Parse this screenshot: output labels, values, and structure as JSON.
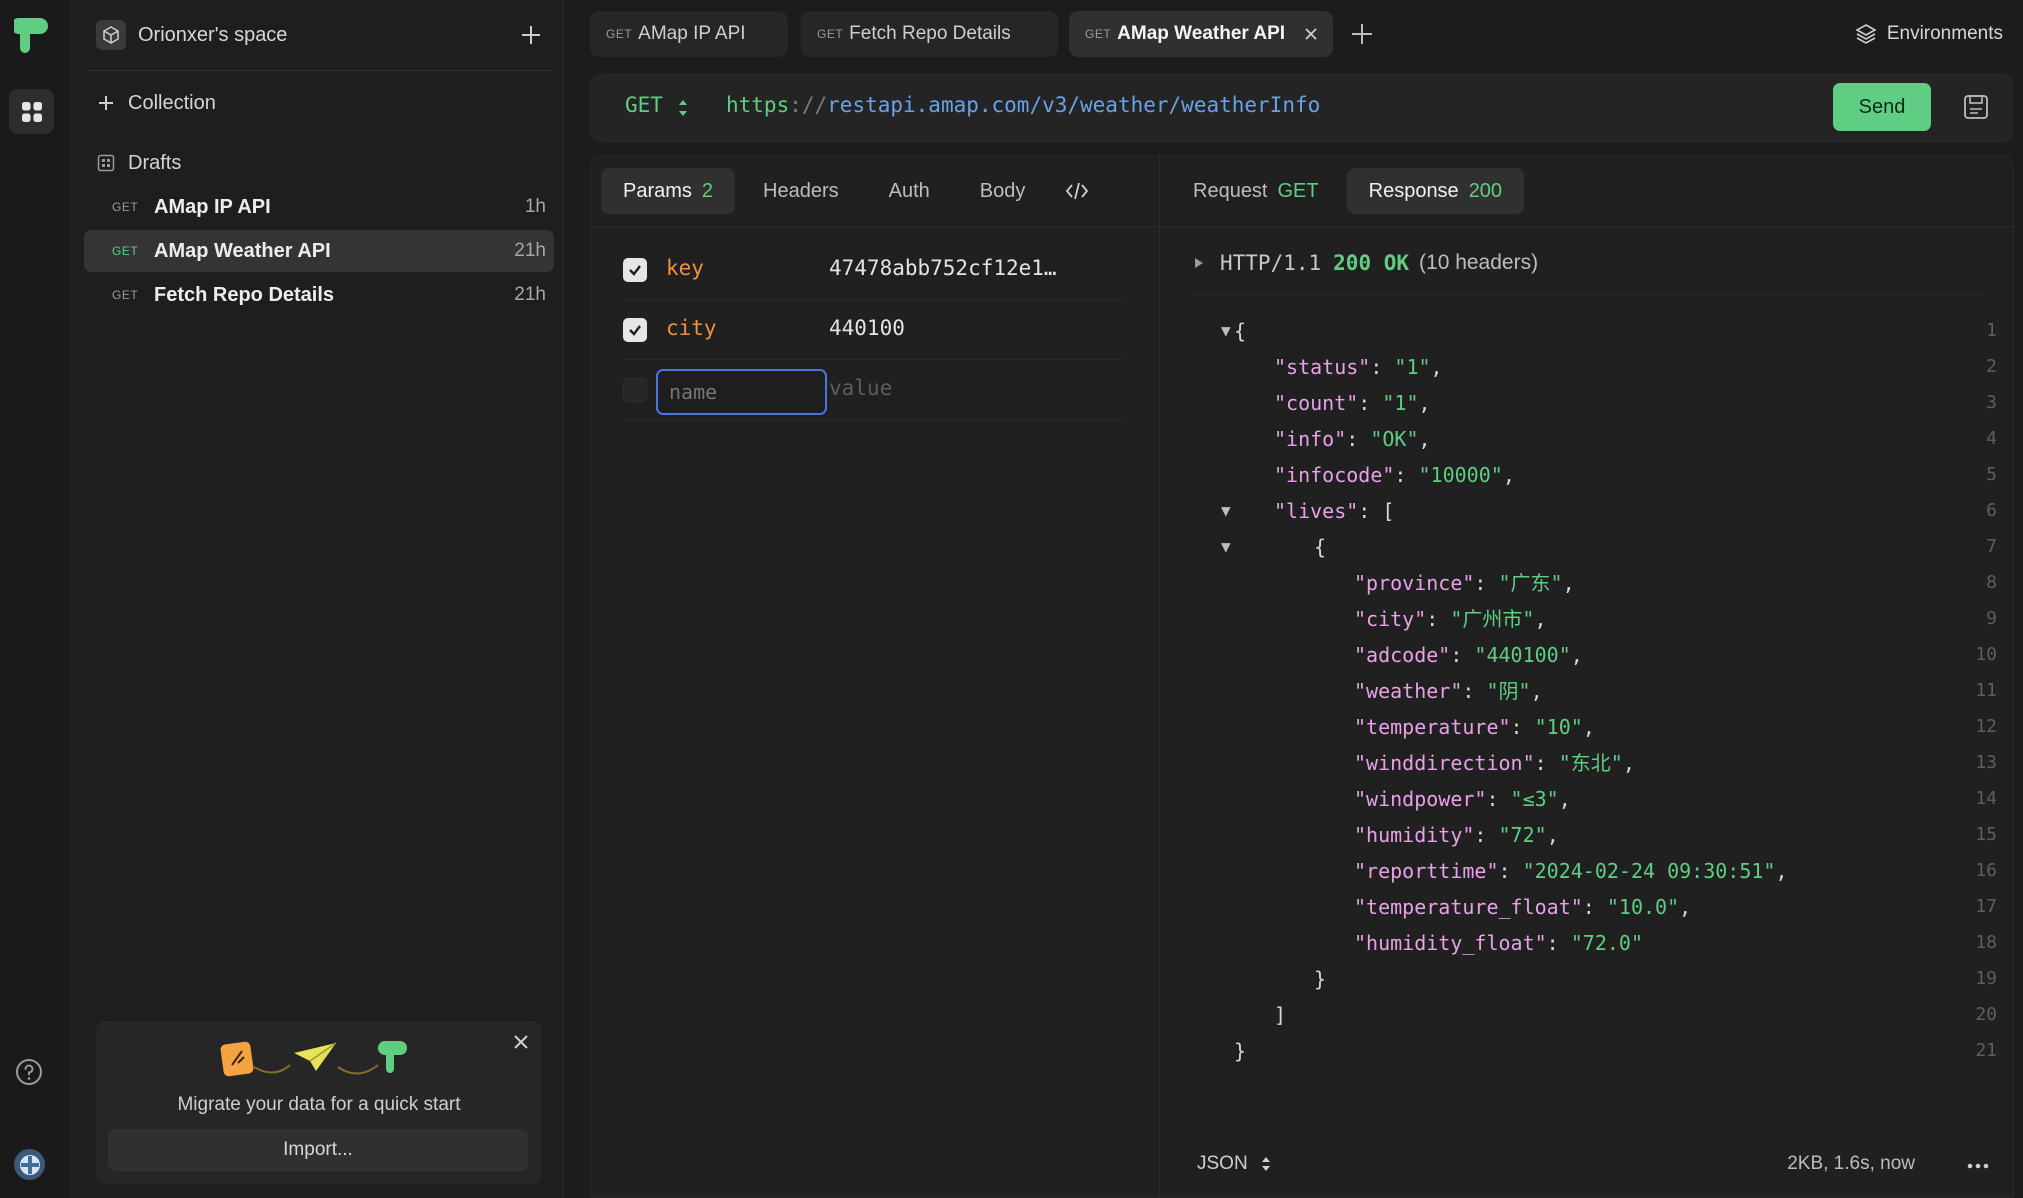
{
  "workspace": {
    "name": "Orionxer's space"
  },
  "sidebar": {
    "collection_label": "Collection",
    "drafts_label": "Drafts",
    "requests": [
      {
        "method": "GET",
        "title": "AMap IP API",
        "age": "1h"
      },
      {
        "method": "GET",
        "title": "AMap Weather API",
        "age": "21h"
      },
      {
        "method": "GET",
        "title": "Fetch Repo Details",
        "age": "21h"
      }
    ],
    "migrate": {
      "text": "Migrate your data for a quick start",
      "button": "Import..."
    }
  },
  "tabs": [
    {
      "method": "GET",
      "title": "AMap IP API"
    },
    {
      "method": "GET",
      "title": "Fetch Repo Details"
    },
    {
      "method": "GET",
      "title": "AMap Weather API"
    }
  ],
  "environments_label": "Environments",
  "request": {
    "method": "GET",
    "url_protocol": "https",
    "url_sep": "://",
    "url_host": "restapi.amap.com",
    "url_path": "/v3/weather/weatherInfo",
    "send_label": "Send"
  },
  "subtabs": {
    "params_label": "Params",
    "params_count": "2",
    "headers_label": "Headers",
    "auth_label": "Auth",
    "body_label": "Body"
  },
  "params": [
    {
      "key": "key",
      "value": "47478abb752cf12e1…",
      "enabled": true
    },
    {
      "key": "city",
      "value": "440100",
      "enabled": true
    }
  ],
  "new_param": {
    "name_placeholder": "name",
    "value_placeholder": "value"
  },
  "response_tabs": {
    "request_label": "Request",
    "request_method": "GET",
    "response_label": "Response",
    "response_status": "200"
  },
  "response": {
    "http_version": "HTTP/1.1",
    "status_text": "200 OK",
    "headers_count": "(10 headers)",
    "format": "JSON",
    "stats": "2KB, 1.6s, now",
    "lines": [
      {
        "n": "1",
        "fold": "▼",
        "indent": 0,
        "parts": [
          [
            "pun",
            "{"
          ]
        ]
      },
      {
        "n": "2",
        "indent": 1,
        "parts": [
          [
            "key",
            "\"status\""
          ],
          [
            "pun",
            ": "
          ],
          [
            "str",
            "\"1\""
          ],
          [
            "pun",
            ","
          ]
        ]
      },
      {
        "n": "3",
        "indent": 1,
        "parts": [
          [
            "key",
            "\"count\""
          ],
          [
            "pun",
            ": "
          ],
          [
            "str",
            "\"1\""
          ],
          [
            "pun",
            ","
          ]
        ]
      },
      {
        "n": "4",
        "indent": 1,
        "parts": [
          [
            "key",
            "\"info\""
          ],
          [
            "pun",
            ": "
          ],
          [
            "str",
            "\"OK\""
          ],
          [
            "pun",
            ","
          ]
        ]
      },
      {
        "n": "5",
        "indent": 1,
        "parts": [
          [
            "key",
            "\"infocode\""
          ],
          [
            "pun",
            ": "
          ],
          [
            "str",
            "\"10000\""
          ],
          [
            "pun",
            ","
          ]
        ]
      },
      {
        "n": "6",
        "fold": "▼",
        "indent": 1,
        "parts": [
          [
            "key",
            "\"lives\""
          ],
          [
            "pun",
            ": ["
          ]
        ]
      },
      {
        "n": "7",
        "fold": "▼",
        "indent": 2,
        "parts": [
          [
            "pun",
            "{"
          ]
        ]
      },
      {
        "n": "8",
        "indent": 3,
        "parts": [
          [
            "key",
            "\"province\""
          ],
          [
            "pun",
            ": "
          ],
          [
            "str",
            "\"广东\""
          ],
          [
            "pun",
            ","
          ]
        ]
      },
      {
        "n": "9",
        "indent": 3,
        "parts": [
          [
            "key",
            "\"city\""
          ],
          [
            "pun",
            ": "
          ],
          [
            "str",
            "\"广州市\""
          ],
          [
            "pun",
            ","
          ]
        ]
      },
      {
        "n": "10",
        "indent": 3,
        "parts": [
          [
            "key",
            "\"adcode\""
          ],
          [
            "pun",
            ": "
          ],
          [
            "str",
            "\"440100\""
          ],
          [
            "pun",
            ","
          ]
        ]
      },
      {
        "n": "11",
        "indent": 3,
        "parts": [
          [
            "key",
            "\"weather\""
          ],
          [
            "pun",
            ": "
          ],
          [
            "str",
            "\"阴\""
          ],
          [
            "pun",
            ","
          ]
        ]
      },
      {
        "n": "12",
        "indent": 3,
        "parts": [
          [
            "key",
            "\"temperature\""
          ],
          [
            "pun",
            ": "
          ],
          [
            "str",
            "\"10\""
          ],
          [
            "pun",
            ","
          ]
        ]
      },
      {
        "n": "13",
        "indent": 3,
        "parts": [
          [
            "key",
            "\"winddirection\""
          ],
          [
            "pun",
            ": "
          ],
          [
            "str",
            "\"东北\""
          ],
          [
            "pun",
            ","
          ]
        ]
      },
      {
        "n": "14",
        "indent": 3,
        "parts": [
          [
            "key",
            "\"windpower\""
          ],
          [
            "pun",
            ": "
          ],
          [
            "str",
            "\"≤3\""
          ],
          [
            "pun",
            ","
          ]
        ]
      },
      {
        "n": "15",
        "indent": 3,
        "parts": [
          [
            "key",
            "\"humidity\""
          ],
          [
            "pun",
            ": "
          ],
          [
            "str",
            "\"72\""
          ],
          [
            "pun",
            ","
          ]
        ]
      },
      {
        "n": "16",
        "indent": 3,
        "parts": [
          [
            "key",
            "\"reporttime\""
          ],
          [
            "pun",
            ": "
          ],
          [
            "str",
            "\"2024-02-24 09:30:51\""
          ],
          [
            "pun",
            ","
          ]
        ]
      },
      {
        "n": "17",
        "indent": 3,
        "parts": [
          [
            "key",
            "\"temperature_float\""
          ],
          [
            "pun",
            ": "
          ],
          [
            "str",
            "\"10.0\""
          ],
          [
            "pun",
            ","
          ]
        ]
      },
      {
        "n": "18",
        "indent": 3,
        "parts": [
          [
            "key",
            "\"humidity_float\""
          ],
          [
            "pun",
            ": "
          ],
          [
            "str",
            "\"72.0\""
          ]
        ]
      },
      {
        "n": "19",
        "indent": 2,
        "parts": [
          [
            "pun",
            "}"
          ]
        ]
      },
      {
        "n": "20",
        "indent": 1,
        "parts": [
          [
            "pun",
            "]"
          ]
        ]
      },
      {
        "n": "21",
        "indent": 0,
        "parts": [
          [
            "pun",
            "}"
          ]
        ]
      }
    ]
  },
  "colors": {
    "accent_green": "#5fce83",
    "key_orange": "#f2913b",
    "json_key": "#e8a1e8",
    "url_host": "#6aa2e8",
    "focus_blue": "#4a74e0"
  }
}
